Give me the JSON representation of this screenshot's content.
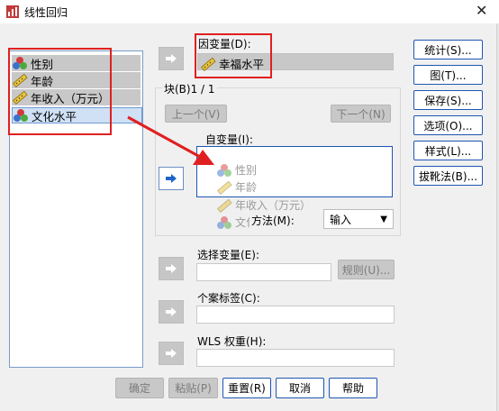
{
  "window": {
    "title": "线性回归"
  },
  "source_vars": [
    {
      "label": "性别",
      "icon": "nominal-icon"
    },
    {
      "label": "年龄",
      "icon": "scale-ruler-icon"
    },
    {
      "label": "年收入（万元）",
      "icon": "scale-ruler-icon"
    },
    {
      "label": "文化水平",
      "icon": "nominal-icon"
    }
  ],
  "dependent": {
    "label": "因变量(D):",
    "value": "幸福水平"
  },
  "block": {
    "label": "块(B)1 / 1",
    "prev": "上一个(V)",
    "next": "下一个(N)"
  },
  "independent": {
    "label": "自变量(I):",
    "ghost_items": [
      "性别",
      "年龄",
      "年收入（万元）",
      "文化水平"
    ]
  },
  "method": {
    "label": "方法(M):",
    "value": "输入"
  },
  "selection": {
    "label": "选择变量(E):",
    "rule": "规则(U)..."
  },
  "case_label": {
    "label": "个案标签(C):"
  },
  "wls": {
    "label": "WLS 权重(H):"
  },
  "right_buttons": [
    "统计(S)...",
    "图(T)...",
    "保存(S)...",
    "选项(O)...",
    "样式(L)...",
    "拔靴法(B)..."
  ],
  "bottom_buttons": {
    "ok": "确定",
    "paste": "粘贴(P)",
    "reset": "重置(R)",
    "cancel": "取消",
    "help": "帮助"
  }
}
